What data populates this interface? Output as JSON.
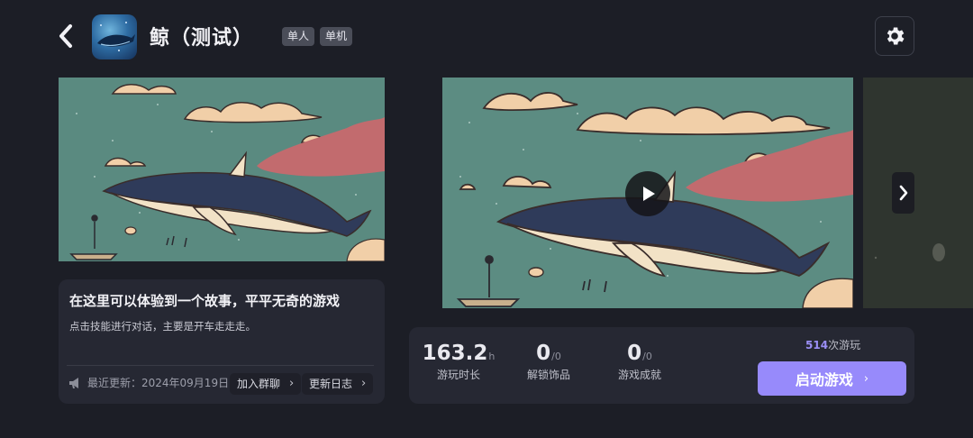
{
  "header": {
    "title": "鲸（测试）",
    "tags": [
      "单人",
      "单机"
    ]
  },
  "icons": {
    "back": "chevron-left-icon",
    "settings": "gear-icon",
    "play": "play-icon",
    "next": "chevron-right-icon",
    "megaphone": "megaphone-icon"
  },
  "description": {
    "title": "在这里可以体验到一个故事，平平无奇的游戏",
    "subtitle": "点击技能进行对话，主要是开车走走走。",
    "last_update": "最近更新：2024年09月19日",
    "join_group_label": "加入群聊",
    "changelog_label": "更新日志"
  },
  "stats": {
    "playtime_value": "163.2",
    "playtime_unit": "h",
    "playtime_label": "游玩时长",
    "items_value": "0",
    "items_unit": "/0",
    "items_label": "解锁饰品",
    "achievements_value": "0",
    "achievements_unit": "/0",
    "achievements_label": "游戏成就",
    "play_count_number": "514",
    "play_count_suffix": "次游玩",
    "launch_label": "启动游戏"
  },
  "colors": {
    "background": "#1c1e26",
    "card": "#262833",
    "accent": "#978afb"
  }
}
